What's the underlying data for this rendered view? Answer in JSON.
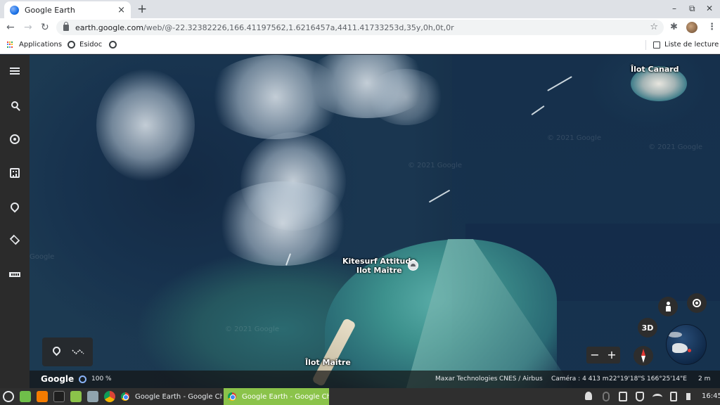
{
  "browser": {
    "tab": {
      "title": "Google Earth",
      "close": "×"
    },
    "new_tab": "+",
    "window_controls": {
      "minimize": "–",
      "restore": "⧉",
      "close": "✕"
    },
    "nav": {
      "back": "←",
      "forward": "→",
      "reload": "↻"
    },
    "address": {
      "host": "earth.google.com",
      "path": "/web/@-22.32382226,166.41197562,1.6216457a,4411.41733253d,35y,0h,0t,0r",
      "star": "☆"
    },
    "toolbar_right": {
      "extensions": "✱",
      "menu": "⋮"
    },
    "bookmarks": {
      "apps": "Applications",
      "esidoc": "Esidoc",
      "reading_list": "Liste de lecture"
    }
  },
  "earth": {
    "labels": {
      "place_title_line1": "Kitesurf Attitude",
      "place_title_line2": "Ilot Maître",
      "islet_bottom": "Îlot Maitre",
      "islet_top": "Îlot Canard"
    },
    "watermarks": [
      "© 2021 Google",
      "© 2021 Google",
      "© 2021 Google",
      "© 2021 Google",
      "Google"
    ],
    "controls": {
      "view_3d": "3D",
      "zoom_out": "−",
      "zoom_in": "+"
    },
    "statusbar": {
      "brand": "Google",
      "loading": "100 %",
      "credits_1": "Maxar Technologies",
      "credits_2": "CNES / Airbus",
      "camera": "Caméra : 4 413 m",
      "coords": "22°19'18\"S 166°25'14\"E",
      "scale": "2 m"
    }
  },
  "taskbar": {
    "window_1": "Google Earth - Google Chr...",
    "window_2": "Google Earth - Google Chr...",
    "clock": "16:45"
  },
  "colors": {
    "sidebar": "#2b2b2b",
    "taskbar": "#2f2f2f",
    "active_window": "#8bc34a",
    "accent_blue": "#1a73e8"
  }
}
